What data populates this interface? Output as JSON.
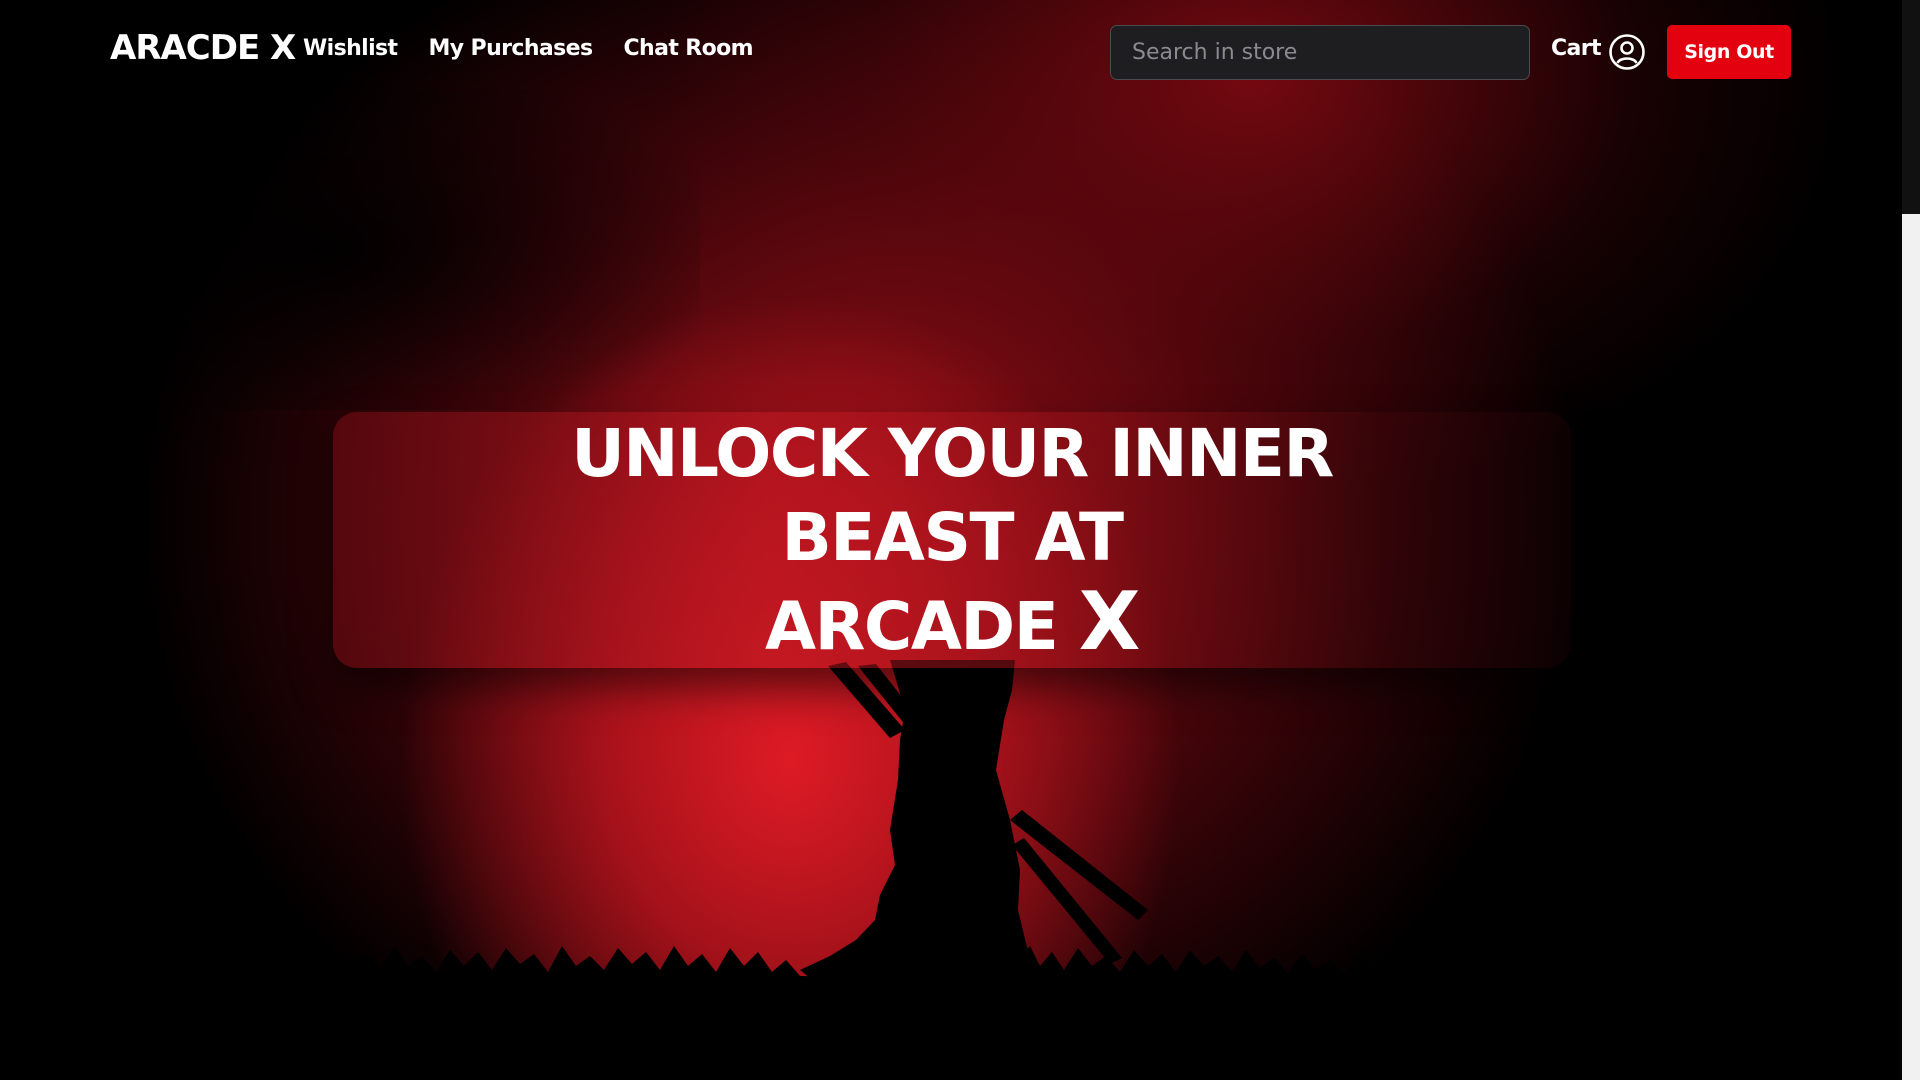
{
  "brand": {
    "logo": "ARACDE X"
  },
  "nav": {
    "links": [
      {
        "label": "Wishlist"
      },
      {
        "label": "My Purchases"
      },
      {
        "label": "Chat Room"
      }
    ],
    "search": {
      "placeholder": "Search in store",
      "value": ""
    },
    "cart_label": "Cart",
    "user_icon": "user-circle-icon",
    "signout_label": "Sign Out"
  },
  "hero": {
    "line1": "UNLOCK YOUR INNER BEAST AT",
    "line2_text": "ARCADE ",
    "line2_x": "X"
  },
  "colors": {
    "accent": "#e3000f",
    "background": "#000000",
    "glow": "#e41c26"
  }
}
